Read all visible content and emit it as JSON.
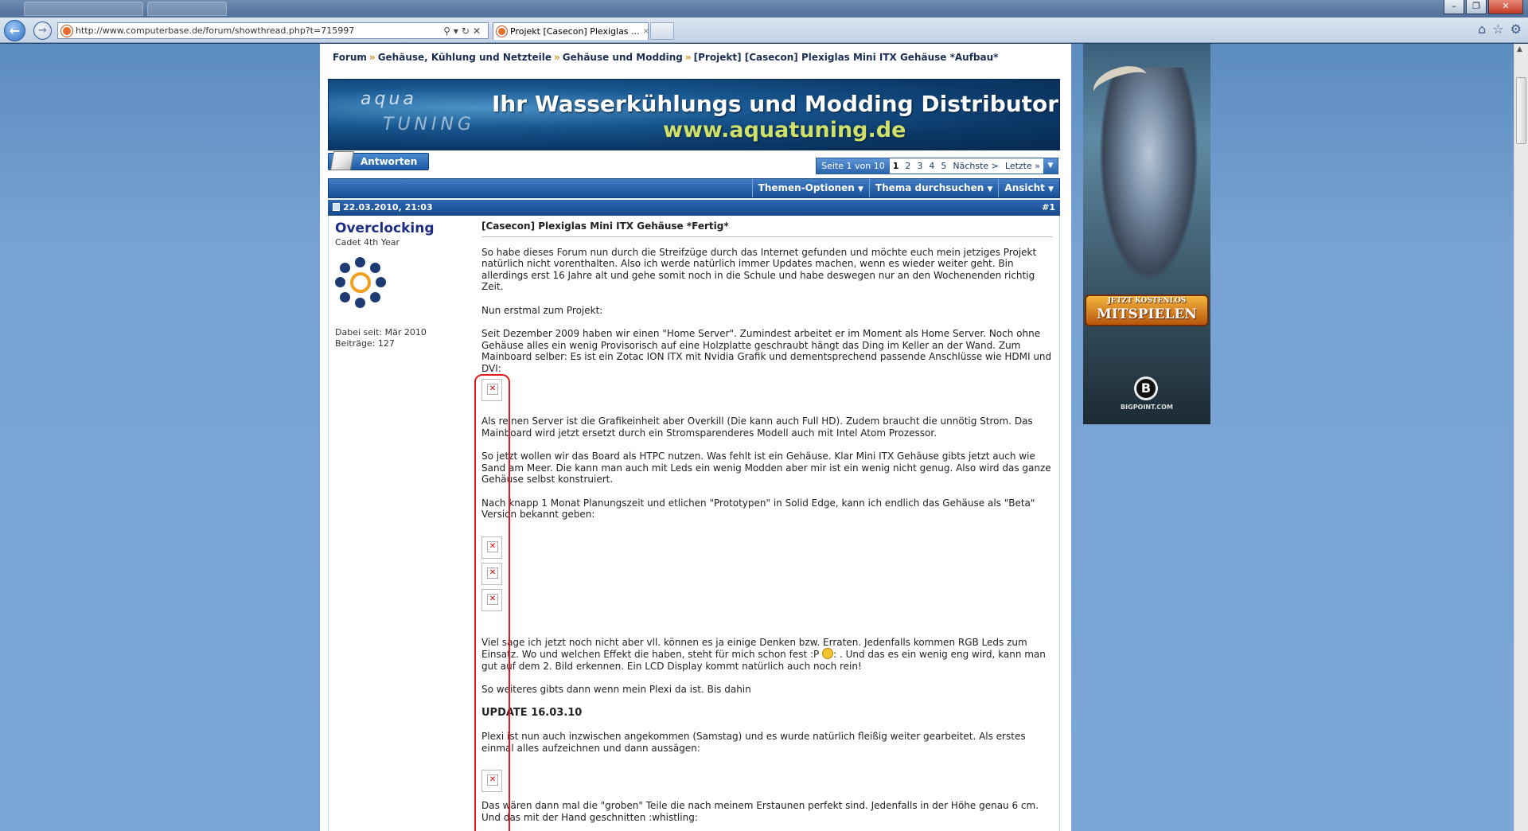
{
  "browser": {
    "url": "http://www.computerbase.de/forum/showthread.php?t=715997",
    "tab_title": "Projekt [Casecon] Plexiglas ...",
    "tab_close": "×"
  },
  "breadcrumb": {
    "items": [
      "Forum",
      "Gehäuse, Kühlung und Netzteile",
      "Gehäuse und Modding",
      "[Projekt] [Casecon] Plexiglas Mini ITX Gehäuse *Aufbau*"
    ],
    "separator": "»"
  },
  "banner": {
    "logo_top": "aqua",
    "logo_bottom": "TUNING",
    "headline": "Ihr Wasserkühlungs und Modding Distributor",
    "url": "www.aquatuning.de"
  },
  "reply_button": {
    "label": "Antworten"
  },
  "pager": {
    "label": "Seite 1 von 10",
    "pages": [
      "1",
      "2",
      "3",
      "4",
      "5"
    ],
    "next": "Nächste >",
    "last": "Letzte »"
  },
  "thread_menu": {
    "options": "Themen-Optionen",
    "search": "Thema durchsuchen",
    "view": "Ansicht"
  },
  "post": {
    "date": "22.03.2010, 21:03",
    "number": "#1",
    "user": {
      "name": "Overclocking",
      "title": "Cadet 4th Year",
      "joined": "Dabei seit: Mär 2010",
      "posts": "Beiträge: 127"
    },
    "title": "[Casecon] Plexiglas Mini ITX Gehäuse *Fertig*",
    "p1": "So habe dieses Forum nun durch die Streifzüge durch das Internet gefunden und möchte euch mein jetziges Projekt natürlich nicht vorenthalten. Also ich werde natürlich immer Updates machen, wenn es wieder weiter geht. Bin allerdings erst 16 Jahre alt und gehe somit noch in die Schule und habe deswegen nur an den Wochenenden richtig Zeit.",
    "p2": "Nun erstmal zum Projekt:",
    "p3": "Seit Dezember 2009 haben wir einen \"Home Server\". Zumindest arbeitet er im Moment als Home Server. Noch ohne Gehäuse alles ein wenig Provisorisch auf eine Holzplatte geschraubt hängt das Ding im Keller an der Wand. Zum Mainboard selber: Es ist ein Zotac ION ITX mit Nvidia Grafik und dementsprechend passende Anschlüsse wie HDMI und DVI:",
    "p4": "Als reinen Server ist die Grafikeinheit aber Overkill (Die kann auch Full HD). Zudem braucht die unnötig Strom. Das Mainboard wird jetzt ersetzt durch ein Stromsparenderes Modell auch mit Intel Atom Prozessor.",
    "p5": "So jetzt wollen wir das Board als HTPC nutzen. Was fehlt ist ein Gehäuse. Klar Mini ITX Gehäuse gibts jetzt auch wie Sand am Meer. Die kann man auch mit Leds ein wenig Modden aber mir ist ein wenig nicht genug. Also wird das ganze Gehäuse selbst konstruiert.",
    "p6": "Nach knapp 1 Monat Planungszeit und etlichen \"Prototypen\" in Solid Edge, kann ich endlich das Gehäuse als \"Beta\" Version bekannt geben:",
    "p7a": "Viel sage ich jetzt noch nicht aber vll. können es ja einige Denken bzw. Erraten. Jedenfalls kommen RGB Leds zum Einsatz. Wo und welchen Effekt die haben, steht für mich schon fest :P",
    "p7b": ": . Und das es ein wenig eng wird, kann man gut auf dem 2. Bild erkennen. Ein LCD Display kommt natürlich auch noch rein!",
    "p8": "So weiteres gibts dann wenn mein Plexi da ist. Bis dahin",
    "update": "UPDATE 16.03.10",
    "p9": "Plexi ist nun auch inzwischen angekommen (Samstag) und es wurde natürlich fleißig weiter gearbeitet. Als erstes einmal alles aufzeichnen und dann aussägen:",
    "p10": "Das wären dann mal die \"groben\" Teile die nach meinem Erstaunen perfekt sind. Jedenfalls in der Höhe genau 6 cm. Und das mit der Hand geschnitten :whistling:"
  },
  "ad": {
    "cta_small": "JETZT KOSTENLOS",
    "cta_big": "MITSPIELEN",
    "brand_letter": "B",
    "brand": "BIGPOINT.COM"
  }
}
